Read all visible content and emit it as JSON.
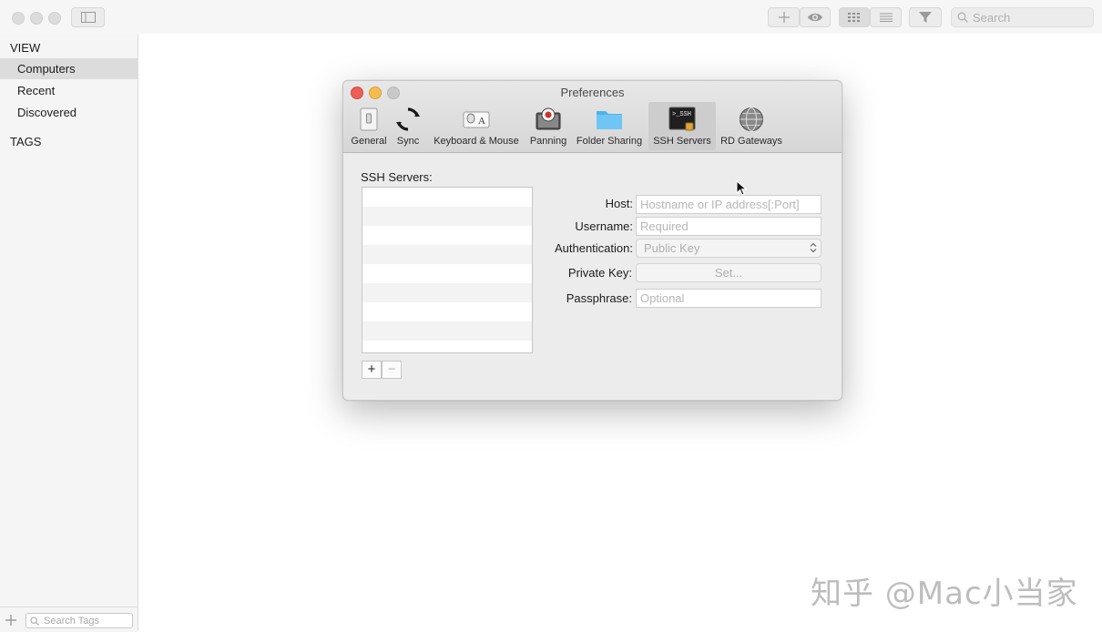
{
  "toolbar": {
    "search_placeholder": "Search",
    "icons": [
      "sidebar-toggle-icon",
      "plus-icon",
      "eye-icon",
      "grid-icon",
      "list-icon",
      "filter-icon",
      "search-icon"
    ]
  },
  "sidebar": {
    "view_heading": "VIEW",
    "items": [
      {
        "label": "Computers",
        "selected": true
      },
      {
        "label": "Recent",
        "selected": false
      },
      {
        "label": "Discovered",
        "selected": false
      }
    ],
    "tags_heading": "TAGS",
    "search_tags_placeholder": "Search Tags"
  },
  "preferences": {
    "title": "Preferences",
    "tabs": [
      {
        "label": "General",
        "icon": "general-switch-icon"
      },
      {
        "label": "Sync",
        "icon": "sync-icon"
      },
      {
        "label": "Keyboard & Mouse",
        "icon": "keyboard-mouse-icon"
      },
      {
        "label": "Panning",
        "icon": "panning-icon"
      },
      {
        "label": "Folder Sharing",
        "icon": "folder-icon"
      },
      {
        "label": "SSH Servers",
        "icon": "terminal-ssh-icon",
        "active": true
      },
      {
        "label": "RD Gateways",
        "icon": "globe-icon"
      }
    ],
    "ssh_servers_label": "SSH Servers:",
    "add_label": "+",
    "remove_label": "−",
    "fields": {
      "host_label": "Host:",
      "host_placeholder": "Hostname or IP address[:Port]",
      "username_label": "Username:",
      "username_placeholder": "Required",
      "auth_label": "Authentication:",
      "auth_value": "Public Key",
      "private_key_label": "Private Key:",
      "private_key_button": "Set...",
      "passphrase_label": "Passphrase:",
      "passphrase_placeholder": "Optional"
    }
  },
  "watermark": "知乎 @Mac小当家",
  "colors": {
    "close": "#ec5f57",
    "minimize": "#f5bd4f",
    "zoom_disabled": "#c9c9c9",
    "folder": "#5dbcf1"
  }
}
